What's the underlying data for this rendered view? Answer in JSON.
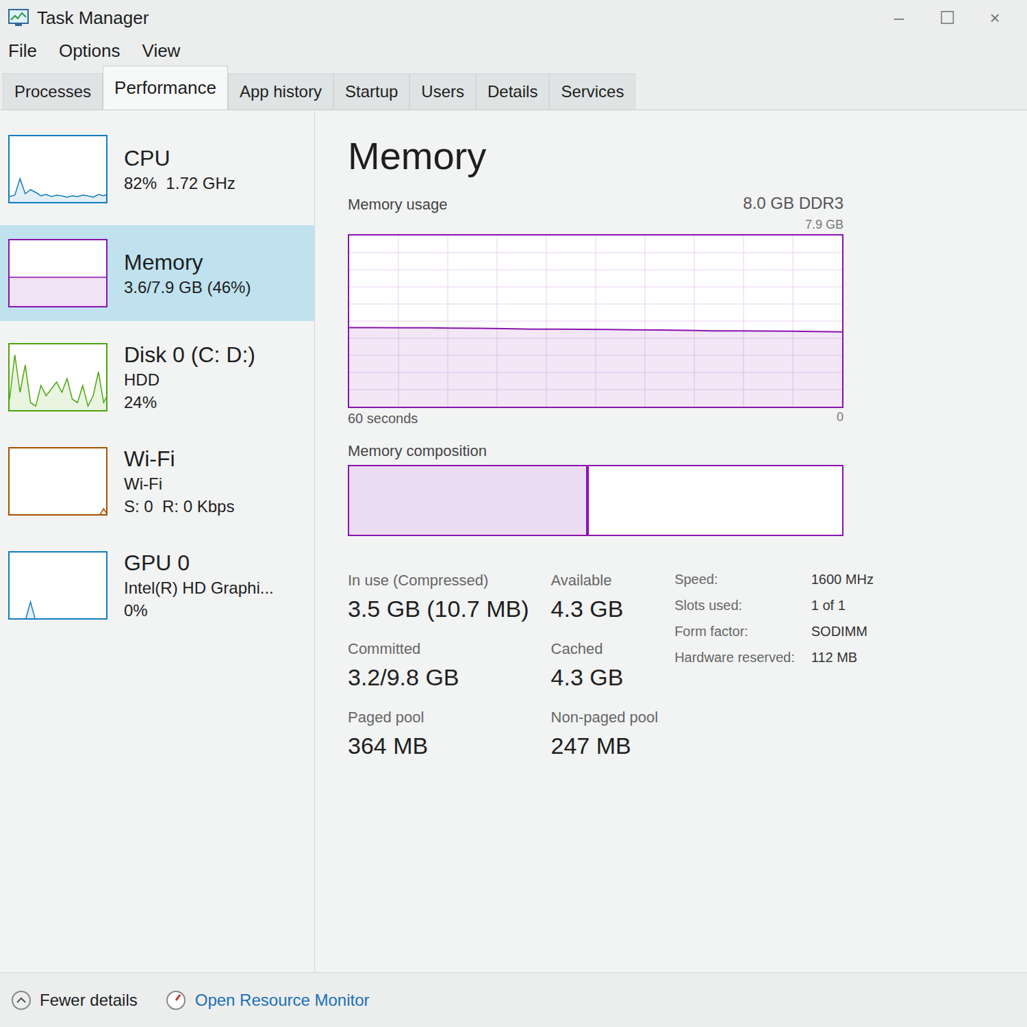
{
  "window": {
    "title": "Task Manager",
    "controls": [
      "–",
      "☐",
      "×"
    ]
  },
  "menu": [
    "File",
    "Options",
    "View"
  ],
  "tabs": [
    {
      "label": "Processes",
      "selected": false
    },
    {
      "label": "Performance",
      "selected": true
    },
    {
      "label": "App history",
      "selected": false
    },
    {
      "label": "Startup",
      "selected": false
    },
    {
      "label": "Users",
      "selected": false
    },
    {
      "label": "Details",
      "selected": false
    },
    {
      "label": "Services",
      "selected": false
    }
  ],
  "sidebar": {
    "items": [
      {
        "name": "CPU",
        "details": [
          "82%  1.72 GHz"
        ],
        "selected": false,
        "color": "#117dbb",
        "values": [
          12,
          14,
          38,
          16,
          22,
          18,
          13,
          15,
          12,
          14,
          13,
          11,
          13,
          12,
          14,
          13,
          11,
          15,
          13,
          16
        ]
      },
      {
        "name": "Memory",
        "details": [
          "3.6/7.9 GB (46%)"
        ],
        "selected": true,
        "color": "#8b12ae",
        "values": [
          46,
          46,
          46,
          46,
          46,
          46,
          46,
          46,
          46,
          46,
          46,
          46,
          46,
          46,
          46,
          46,
          46,
          46,
          46,
          46
        ]
      },
      {
        "name": "Disk 0 (C: D:)",
        "details": [
          "HDD",
          "24%"
        ],
        "selected": false,
        "color": "#4da60c",
        "values": [
          20,
          85,
          30,
          70,
          15,
          10,
          40,
          25,
          35,
          45,
          30,
          50,
          20,
          15,
          40,
          10,
          25,
          60,
          15,
          30
        ]
      },
      {
        "name": "Wi-Fi",
        "details": [
          "Wi-Fi",
          "S: 0  R: 0 Kbps"
        ],
        "selected": false,
        "color": "#a74f01",
        "values": [
          0,
          0,
          0,
          0,
          0,
          0,
          0,
          0,
          0,
          0,
          0,
          0,
          0,
          0,
          0,
          0,
          0,
          0,
          12,
          0
        ]
      },
      {
        "name": "GPU 0",
        "details": [
          "Intel(R) HD Graphi...",
          "0%"
        ],
        "selected": false,
        "color": "#117dbb",
        "values": [
          0,
          0,
          0,
          0,
          28,
          0,
          0,
          0,
          0,
          0,
          0,
          0,
          0,
          0,
          0,
          0,
          0,
          0,
          0,
          0
        ]
      }
    ]
  },
  "detail": {
    "title": "Memory",
    "usage_label": "Memory usage",
    "capacity": "8.0 GB DDR3",
    "axis_max": "7.9 GB",
    "axis_time": "60 seconds",
    "axis_min": "0",
    "usage_values": [
      3.65,
      3.65,
      3.64,
      3.64,
      3.63,
      3.62,
      3.6,
      3.58,
      3.58,
      3.57,
      3.56,
      3.55,
      3.54,
      3.52,
      3.5,
      3.5,
      3.49,
      3.48,
      3.47,
      3.45
    ],
    "composition_label": "Memory composition",
    "composition": [
      {
        "kind": "inuse",
        "level": 0.48
      },
      {
        "kind": "modified",
        "level": 0.006
      },
      {
        "kind": "standby",
        "level": 0.514
      }
    ],
    "stats": [
      {
        "label": "In use (Compressed)",
        "value": "3.5 GB (10.7 MB)"
      },
      {
        "label": "Available",
        "value": "4.3 GB"
      },
      {
        "label": "Committed",
        "value": "3.2/9.8 GB"
      },
      {
        "label": "Cached",
        "value": "4.3 GB"
      },
      {
        "label": "Paged pool",
        "value": "364 MB"
      },
      {
        "label": "Non-paged pool",
        "value": "247 MB"
      }
    ],
    "specs": [
      {
        "label": "Speed:",
        "value": "1600 MHz"
      },
      {
        "label": "Slots used:",
        "value": "1 of 1"
      },
      {
        "label": "Form factor:",
        "value": "SODIMM"
      },
      {
        "label": "Hardware reserved:",
        "value": "112 MB"
      }
    ]
  },
  "footer": {
    "fewer_details": "Fewer details",
    "resource_monitor": "Open Resource Monitor"
  }
}
